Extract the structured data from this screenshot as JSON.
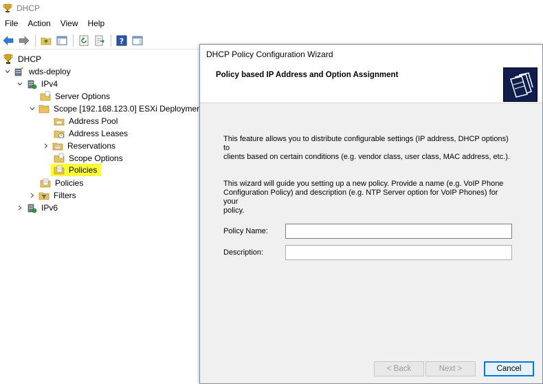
{
  "window": {
    "title": "DHCP"
  },
  "menu": [
    "File",
    "Action",
    "View",
    "Help"
  ],
  "toolbar": {
    "buttons": [
      "back-arrow-icon",
      "forward-arrow-icon",
      "folder-up-icon",
      "show-hide-tree-icon",
      "refresh-icon",
      "export-list-icon",
      "help-icon",
      "show-hide-action-pane-icon"
    ]
  },
  "tree": {
    "root": "DHCP",
    "server": "wds-deploy",
    "ipv4": "IPv4",
    "server_options": "Server Options",
    "scope": "Scope [192.168.123.0] ESXi Deployment",
    "address_pool": "Address Pool",
    "address_leases": "Address Leases",
    "reservations": "Reservations",
    "scope_options": "Scope Options",
    "scope_policies": "Policies",
    "policies": "Policies",
    "filters": "Filters",
    "ipv6": "IPv6"
  },
  "dialog": {
    "title": "DHCP Policy Configuration Wizard",
    "header_title": "Policy based IP Address and Option Assignment",
    "para1_line1": "This feature allows you to distribute configurable settings (IP address, DHCP options) to",
    "para1_line2": "clients based on certain conditions (e.g. vendor class, user class, MAC address, etc.).",
    "para2_line1": "This wizard will guide you setting up a new policy. Provide a name (e.g. VoIP Phone",
    "para2_line2": "Configuration Policy) and description (e.g. NTP Server option for VoIP Phones) for your",
    "para2_line3": "policy.",
    "policy_name_label": "Policy Name:",
    "policy_name_value": "",
    "description_label": "Description:",
    "description_value": "",
    "back_label": "< Back",
    "next_label": "Next >",
    "cancel_label": "Cancel"
  },
  "colors": {
    "highlight": "#ffff38",
    "accent": "#0078d7",
    "dialog_bg": "#f0f0f0"
  }
}
